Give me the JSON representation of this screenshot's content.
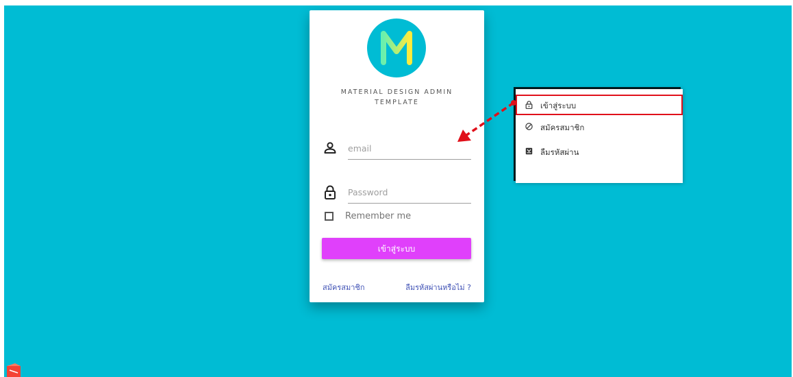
{
  "colors": {
    "background": "#00bcd4",
    "button": "#e040fb",
    "link": "#3f51b5",
    "highlight": "#e0101a"
  },
  "login": {
    "logo_letter": "M",
    "title": "MATERIAL DESIGN ADMIN TEMPLATE",
    "email_placeholder": "email",
    "email_icon": "user-icon",
    "password_placeholder": "Password",
    "password_icon": "lock-icon",
    "remember_label": "Remember me",
    "submit_label": "เข้าสู่ระบบ",
    "register_link": "สมัครสมาชิก",
    "forgot_link": "ลืมรหัสผ่านหรือไม่ ?"
  },
  "menu": {
    "items": [
      {
        "label": "เข้าสู่ระบบ",
        "icon": "lock-icon",
        "highlighted": true
      },
      {
        "label": "สมัครสมาชิก",
        "icon": "block-icon",
        "highlighted": false
      },
      {
        "label": "ลืมรหัสผ่าน",
        "icon": "inbox-icon",
        "highlighted": false
      }
    ]
  }
}
